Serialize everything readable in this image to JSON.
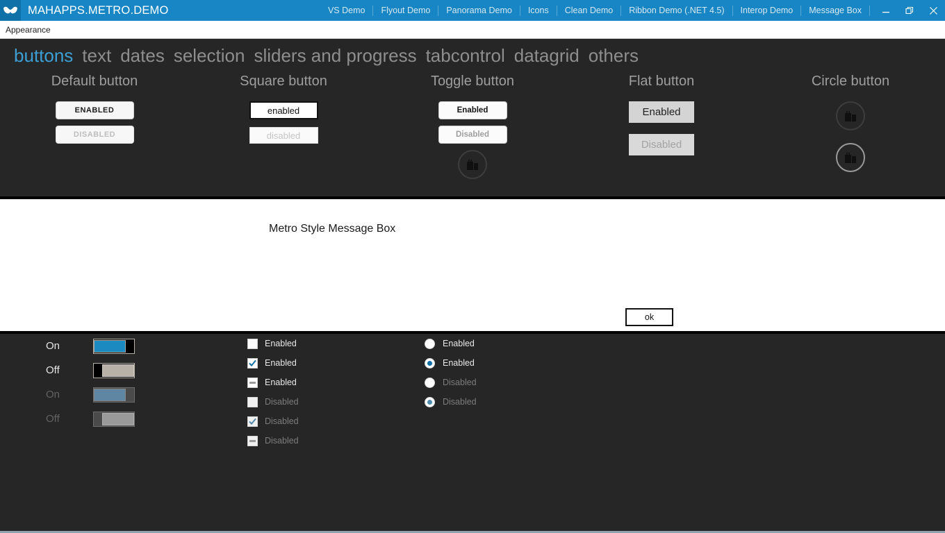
{
  "titlebar": {
    "app_icon": "mustache-icon",
    "title": "MAHAPPS.METRO.DEMO",
    "accent_color": "#1886c4",
    "menu_items": [
      {
        "label": "VS Demo"
      },
      {
        "label": "Flyout Demo"
      },
      {
        "label": "Panorama Demo"
      },
      {
        "label": "Icons"
      },
      {
        "label": "Clean Demo"
      },
      {
        "label": "Ribbon Demo (.NET 4.5)"
      },
      {
        "label": "Interop Demo"
      },
      {
        "label": "Message Box"
      }
    ],
    "window_buttons": [
      {
        "name": "minimize-button",
        "glyph": "minimize-icon"
      },
      {
        "name": "restore-button",
        "glyph": "restore-icon"
      },
      {
        "name": "close-button",
        "glyph": "close-icon"
      }
    ]
  },
  "menubar": {
    "items": [
      {
        "label": "Appearance"
      }
    ]
  },
  "navtabs": {
    "active": "buttons",
    "items": [
      {
        "label": "buttons",
        "active": true
      },
      {
        "label": "text",
        "active": false
      },
      {
        "label": "dates",
        "active": false
      },
      {
        "label": "selection",
        "active": false
      },
      {
        "label": "sliders and progress",
        "active": false
      },
      {
        "label": "tabcontrol",
        "active": false
      },
      {
        "label": "datagrid",
        "active": false
      },
      {
        "label": "others",
        "active": false
      }
    ],
    "active_color": "#3c9fd6",
    "inactive_color": "#8e8e8e"
  },
  "buttons_section": {
    "columns": [
      {
        "title": "Default button",
        "buttons": [
          {
            "label": "ENABLED",
            "enabled": true
          },
          {
            "label": "DISABLED",
            "enabled": false
          }
        ]
      },
      {
        "title": "Square button",
        "buttons": [
          {
            "label": "enabled",
            "enabled": true
          },
          {
            "label": "disabled",
            "enabled": false
          }
        ]
      },
      {
        "title": "Toggle button",
        "buttons": [
          {
            "label": "Enabled",
            "enabled": true
          },
          {
            "label": "Disabled",
            "enabled": false
          }
        ],
        "icon_button": "city-buildings-icon"
      },
      {
        "title": "Flat button",
        "buttons": [
          {
            "label": "Enabled",
            "enabled": true
          },
          {
            "label": "Disabled",
            "enabled": false
          }
        ]
      },
      {
        "title": "Circle button",
        "icon_buttons": [
          {
            "icon": "city-buildings-icon",
            "enabled": true
          },
          {
            "icon": "city-buildings-icon",
            "enabled": false
          }
        ]
      }
    ]
  },
  "messagebox": {
    "message": "Metro Style Message Box",
    "ok_label": "ok",
    "background": "#ffffff"
  },
  "selection": {
    "toggles": [
      {
        "label": "On",
        "state": "on",
        "enabled": true
      },
      {
        "label": "Off",
        "state": "off",
        "enabled": true
      },
      {
        "label": "On",
        "state": "on",
        "enabled": false
      },
      {
        "label": "Off",
        "state": "off",
        "enabled": false
      }
    ],
    "checkboxes": [
      {
        "label": "Enabled",
        "state": "unchecked",
        "enabled": true
      },
      {
        "label": "Enabled",
        "state": "checked",
        "enabled": true
      },
      {
        "label": "Enabled",
        "state": "indeterminate",
        "enabled": true
      },
      {
        "label": "Disabled",
        "state": "unchecked",
        "enabled": false
      },
      {
        "label": "Disabled",
        "state": "checked",
        "enabled": false
      },
      {
        "label": "Disabled",
        "state": "indeterminate",
        "enabled": false
      }
    ],
    "radios": [
      {
        "label": "Enabled",
        "selected": false,
        "enabled": true
      },
      {
        "label": "Enabled",
        "selected": true,
        "enabled": true
      },
      {
        "label": "Disabled",
        "selected": false,
        "enabled": false
      },
      {
        "label": "Disabled",
        "selected": true,
        "enabled": false
      }
    ],
    "check_color": "#0f6ea8",
    "switch_on_color": "#1b8ac0",
    "switch_off_color": "#b7b1a7"
  }
}
